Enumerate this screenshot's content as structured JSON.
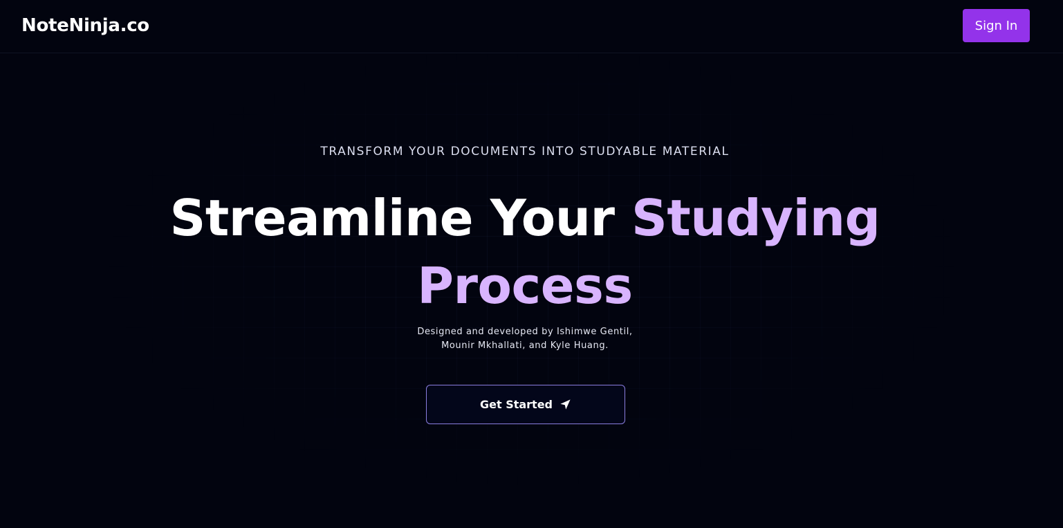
{
  "navbar": {
    "logo": "NoteNinja.co",
    "signin_label": "Sign In"
  },
  "hero": {
    "eyebrow": "TRANSFORM YOUR DOCUMENTS INTO STUDYABLE MATERIAL",
    "headline_part1": "Streamline Your ",
    "headline_accent1": "Studying",
    "headline_accent2": "Process",
    "credit_line1": "Designed and developed by Ishimwe Gentil,",
    "credit_line2": "Mounir Mkhallati, and Kyle Huang.",
    "cta_label": "Get Started",
    "cta_icon": "paper-plane-icon"
  },
  "colors": {
    "background": "#02040f",
    "accent": "#9333ea",
    "headline_accent": "#d8b4fe",
    "cta_border": "#8b7ee0"
  }
}
